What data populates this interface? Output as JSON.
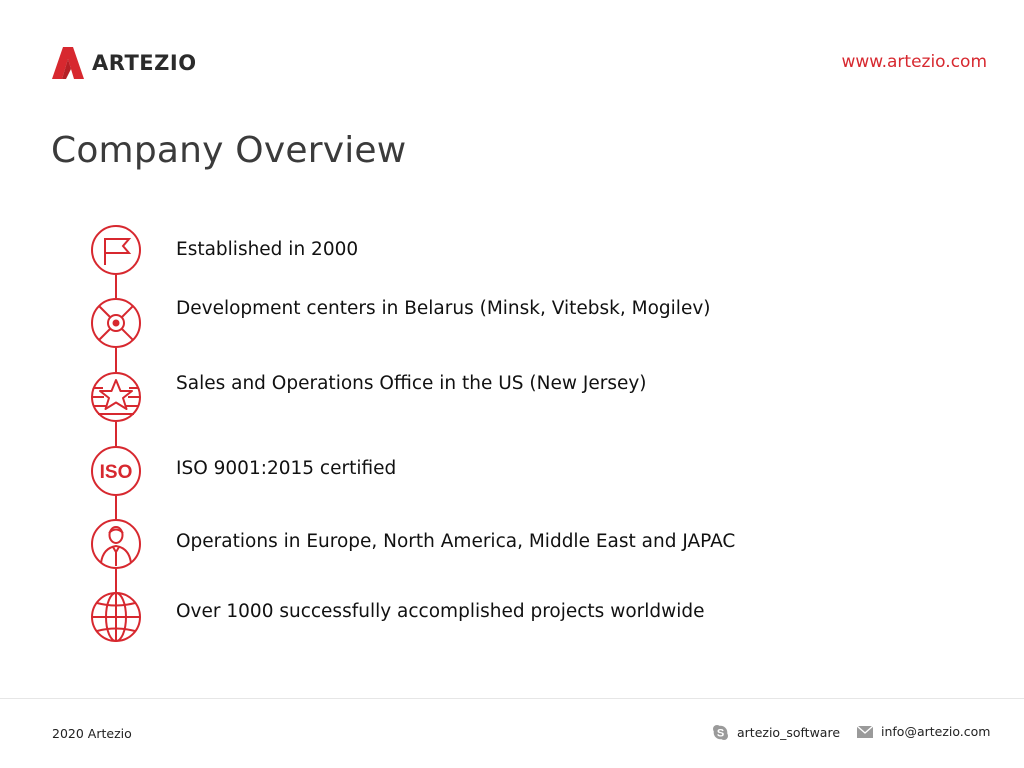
{
  "header": {
    "logo_text": "ARTEZIO",
    "website": "www.artezio.com"
  },
  "page": {
    "title": "Company Overview"
  },
  "facts": [
    {
      "text": "Established in 2000",
      "icon": "flag-icon"
    },
    {
      "text": "Development centers in Belarus (Minsk, Vitebsk, Mogilev)",
      "icon": "target-icon"
    },
    {
      "text": "Sales and Operations Office in the US (New Jersey)",
      "icon": "star-flag-icon"
    },
    {
      "text": "ISO 9001:2015 certified",
      "icon": "iso-icon",
      "icon_label": "ISO"
    },
    {
      "text": "Operations in Europe, North America, Middle East and JAPAC",
      "icon": "person-icon"
    },
    {
      "text": "Over 1000 successfully accomplished projects worldwide",
      "icon": "globe-icon"
    }
  ],
  "footer": {
    "copyright": "2020 Artezio",
    "skype": "artezio_software",
    "email": "info@artezio.com"
  },
  "colors": {
    "accent": "#d7282f",
    "title": "#3b3b3b",
    "text": "#111111",
    "footer_icon": "#9a9a9a"
  }
}
